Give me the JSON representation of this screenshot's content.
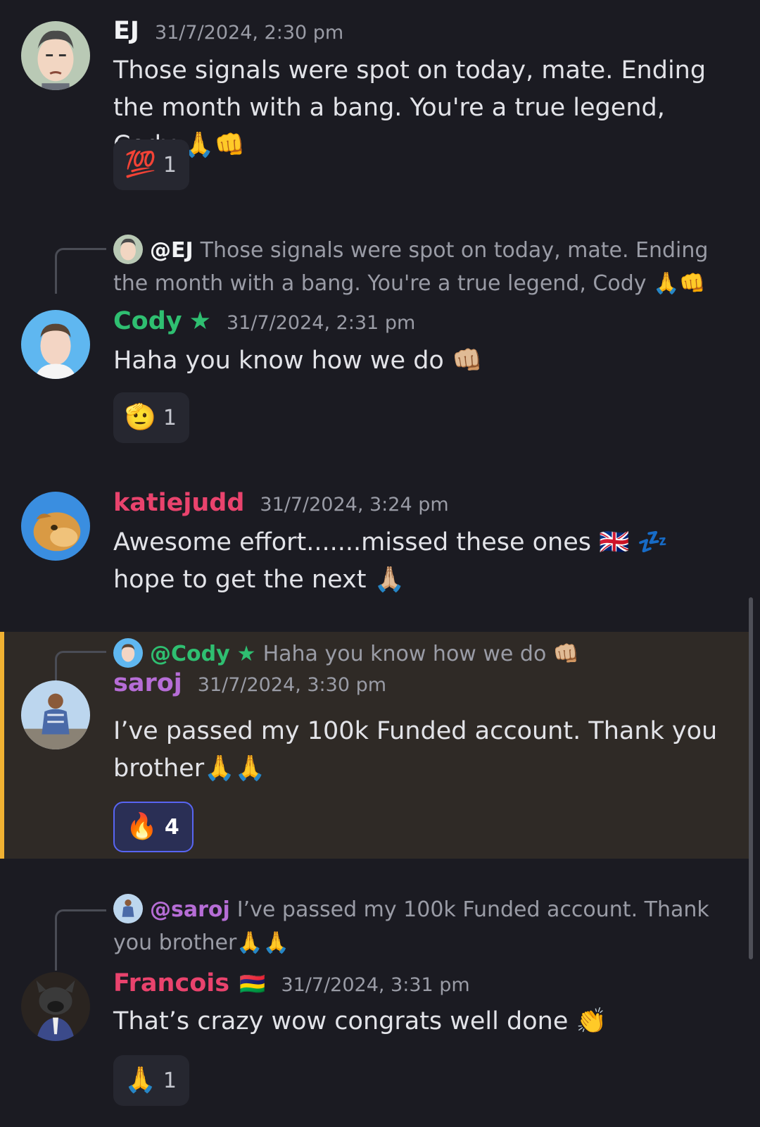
{
  "colors": {
    "background": "#1b1b22",
    "timestamp": "#9a9ca6",
    "highlight_bar": "#f0b132",
    "reaction_active_border": "#5865f2",
    "role_green": "#2fbf71",
    "role_pink": "#e9436d",
    "role_purple": "#b66dd6",
    "role_white": "#f2f3f5"
  },
  "messages": [
    {
      "author": "EJ",
      "timestamp": "31/7/2024, 2:30 pm",
      "text": "Those signals were spot on today, mate. Ending the month with a bang. You're a true legend, Cody 🙏👊",
      "reaction": {
        "emoji": "💯",
        "count": "1"
      }
    },
    {
      "reply": {
        "mention": "@EJ",
        "text": "Those signals were spot on today, mate. Ending the month with a bang. You're a true legend, Cody 🙏👊"
      },
      "author": "Cody",
      "badge": "★",
      "timestamp": "31/7/2024, 2:31 pm",
      "text": "Haha you know how we do 👊🏼",
      "reaction": {
        "emoji": "🫡",
        "count": "1"
      }
    },
    {
      "author": "katiejudd",
      "timestamp": "31/7/2024, 3:24 pm",
      "text": "Awesome effort.......missed these ones 🇬🇧 💤 hope to get the next 🙏🏼"
    },
    {
      "reply": {
        "mention": "@Cody",
        "badge": "★",
        "text": "Haha you know how we do 👊🏼"
      },
      "author": "saroj",
      "timestamp": "31/7/2024, 3:30 pm",
      "text": "I’ve passed my 100k Funded account. Thank you brother🙏🙏",
      "reaction": {
        "emoji": "🔥",
        "count": "4"
      }
    },
    {
      "reply": {
        "mention": "@saroj",
        "text": "I’ve passed my 100k Funded account. Thank you brother🙏🙏"
      },
      "author": "Francois",
      "flag": "🇲🇺",
      "timestamp": "31/7/2024, 3:31 pm",
      "text": "That’s crazy wow congrats well done 👏",
      "reaction": {
        "emoji": "🙏",
        "count": "1"
      }
    }
  ],
  "icons": {
    "avatar_ej": "cartoon-face-avatar",
    "avatar_cody": "man-portrait-avatar",
    "avatar_katie": "lion-cub-avatar",
    "avatar_saroj": "man-outdoor-photo-avatar",
    "avatar_francois": "bulldog-in-suit-avatar"
  }
}
